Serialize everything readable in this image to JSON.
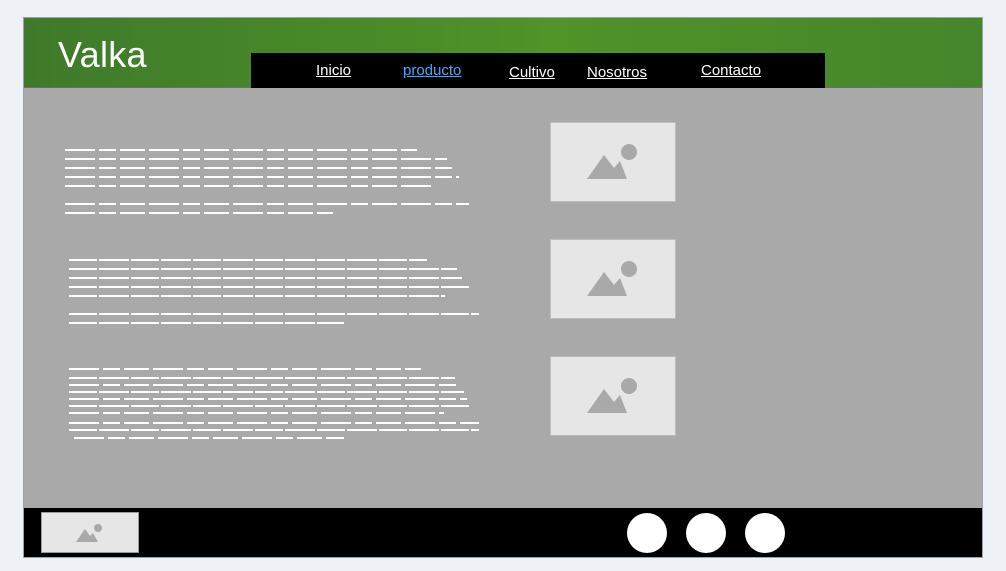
{
  "header": {
    "logo": "Valka"
  },
  "nav": {
    "items": [
      {
        "label": "Inicio",
        "active": false
      },
      {
        "label": "producto",
        "active": true
      },
      {
        "label": "Cultivo",
        "active": false
      },
      {
        "label": "Nosotros",
        "active": false
      },
      {
        "label": "Contacto",
        "active": false
      }
    ]
  },
  "content": {
    "sections": [
      {
        "image": "image-placeholder-icon"
      },
      {
        "image": "image-placeholder-icon"
      },
      {
        "image": "image-placeholder-icon"
      }
    ]
  },
  "footer": {
    "logo_image": "image-placeholder-icon",
    "social_icons": [
      "social-icon",
      "social-icon",
      "social-icon"
    ]
  },
  "colors": {
    "header_green": "#4e9427",
    "nav_background": "#000000",
    "active_link": "#3fa9ff",
    "content_background": "#a9a9a9",
    "placeholder": "#e6e6e6"
  }
}
